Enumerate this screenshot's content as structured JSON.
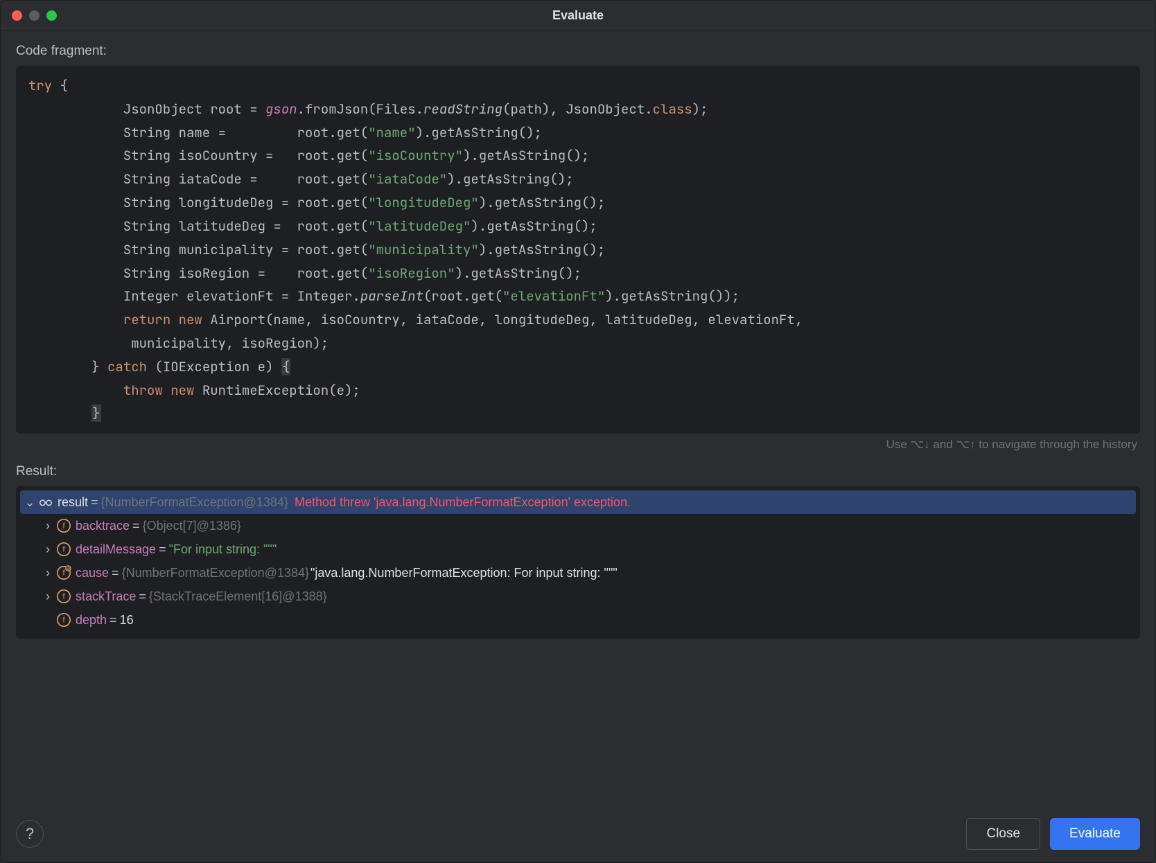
{
  "window": {
    "title": "Evaluate"
  },
  "labels": {
    "code_fragment": "Code fragment:",
    "result": "Result:",
    "hint": "Use ⌥↓ and ⌥↑ to navigate through the history"
  },
  "buttons": {
    "close": "Close",
    "evaluate": "Evaluate",
    "help_tooltip": "?"
  },
  "icons": {
    "glasses": "glasses-icon",
    "field": "field-icon",
    "field_recursive": "field-recursive-icon",
    "expand": "expand-icon"
  },
  "code": {
    "l01a": "try",
    "l01b": " {",
    "l02a": "            JsonObject root = ",
    "l02b": "gson",
    "l02c": ".fromJson(Files.",
    "l02d": "readString",
    "l02e": "(path), JsonObject.",
    "l02f": "class",
    "l02g": ");",
    "l03a": "            String name =         root.get(",
    "l03b": "\"name\"",
    "l03c": ").getAsString();",
    "l04a": "            String isoCountry =   root.get(",
    "l04b": "\"isoCountry\"",
    "l04c": ").getAsString();",
    "l05a": "            String iataCode =     root.get(",
    "l05b": "\"iataCode\"",
    "l05c": ").getAsString();",
    "l06a": "            String longitudeDeg = root.get(",
    "l06b": "\"longitudeDeg\"",
    "l06c": ").getAsString();",
    "l07a": "            String latitudeDeg =  root.get(",
    "l07b": "\"latitudeDeg\"",
    "l07c": ").getAsString();",
    "l08a": "            String municipality = root.get(",
    "l08b": "\"municipality\"",
    "l08c": ").getAsString();",
    "l09a": "            String isoRegion =    root.get(",
    "l09b": "\"isoRegion\"",
    "l09c": ").getAsString();",
    "l10a": "            Integer elevationFt = Integer.",
    "l10b": "parseInt",
    "l10c": "(root.get(",
    "l10d": "\"elevationFt\"",
    "l10e": ").getAsString());",
    "l11a": "            ",
    "l11b": "return new",
    "l11c": " Airport(name, isoCountry, iataCode, longitudeDeg, latitudeDeg, elevationFt,",
    "l12a": "             municipality, isoRegion);",
    "l13a": "        } ",
    "l13b": "catch",
    "l13c": " (IOException e) ",
    "l13d": "{",
    "l14a": "            ",
    "l14b": "throw new",
    "l14c": " RuntimeException(e);",
    "l15a": "        ",
    "l15b": "}"
  },
  "result": {
    "root": {
      "name": "result",
      "ref": "{NumberFormatException@1384}",
      "msg": "Method threw 'java.lang.NumberFormatException' exception."
    },
    "children": [
      {
        "name": "backtrace",
        "eq": " = ",
        "gray": "{Object[7]@1386}",
        "white": "",
        "green": "",
        "expandable": true,
        "icon": "field"
      },
      {
        "name": "detailMessage",
        "eq": " = ",
        "gray": "",
        "white": "",
        "green": "\"For input string: \"\"\"",
        "expandable": true,
        "icon": "field"
      },
      {
        "name": "cause",
        "eq": " = ",
        "gray": "{NumberFormatException@1384} ",
        "white": "\"java.lang.NumberFormatException: For input string: \"\"\"",
        "green": "",
        "expandable": true,
        "icon": "field_recursive"
      },
      {
        "name": "stackTrace",
        "eq": " = ",
        "gray": "{StackTraceElement[16]@1388}",
        "white": "",
        "green": "",
        "expandable": true,
        "icon": "field"
      },
      {
        "name": "depth",
        "eq": " = ",
        "gray": "",
        "white": "16",
        "green": "",
        "expandable": false,
        "icon": "field"
      }
    ]
  }
}
